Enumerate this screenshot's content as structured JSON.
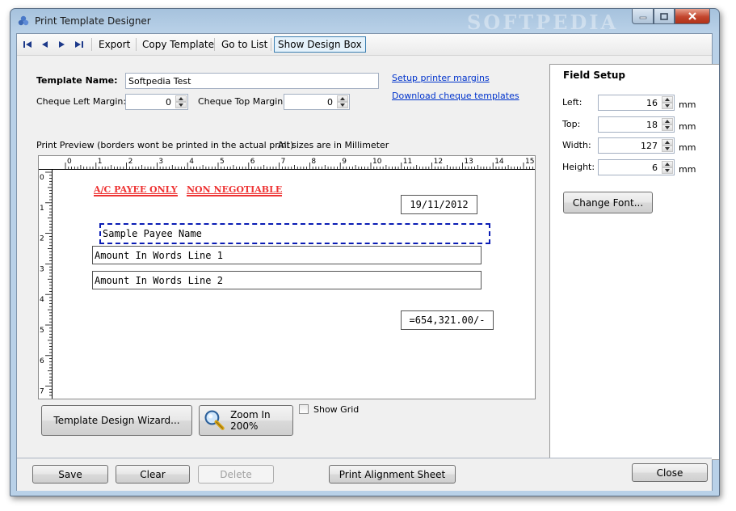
{
  "window": {
    "title": "Print Template Designer",
    "watermark": "SOFTPEDIA"
  },
  "toolbar": {
    "nav": [
      "first-icon",
      "prev-icon",
      "next-icon",
      "last-icon"
    ],
    "export": "Export",
    "copy_template": "Copy Template",
    "go_to_list": "Go to List",
    "show_design_box": "Show Design Box"
  },
  "form": {
    "template_name_label": "Template Name:",
    "template_name_value": "Softpedia Test",
    "cheque_left_margin_label": "Cheque Left Margin:",
    "cheque_left_margin_value": "0",
    "cheque_top_margin_label": "Cheque Top Margin:",
    "cheque_top_margin_value": "0",
    "setup_printer_margins": "Setup printer margins",
    "download_cheque_templates": "Download cheque templates"
  },
  "preview": {
    "caption": "Print Preview (borders wont be printed in the actual print)",
    "units_note": "All sizes are in Millimeter",
    "ruler_top": [
      "0",
      "1",
      "2",
      "3",
      "4",
      "5",
      "6",
      "7",
      "8",
      "9",
      "10",
      "11",
      "12",
      "13",
      "14",
      "15"
    ],
    "ruler_left": [
      "0",
      "1",
      "2",
      "3",
      "4",
      "5",
      "6",
      "7"
    ],
    "stamps": {
      "payee_only": "A/C PAYEE ONLY",
      "non_negotiable": "NON NEGOTIABLE"
    },
    "date": "19/11/2012",
    "payee": "Sample Payee Name",
    "amount_line_1": "Amount In Words Line 1",
    "amount_line_2": "Amount In Words Line 2",
    "amount": "=654,321.00/-"
  },
  "preview_actions": {
    "wizard": "Template Design Wizard...",
    "zoom": "Zoom In 200%",
    "show_grid": "Show Grid",
    "show_grid_checked": false
  },
  "field_setup": {
    "title": "Field Setup",
    "left_label": "Left:",
    "left_value": "16",
    "top_label": "Top:",
    "top_value": "18",
    "width_label": "Width:",
    "width_value": "127",
    "height_label": "Height:",
    "height_value": "6",
    "unit": "mm",
    "change_font": "Change Font..."
  },
  "bottom": {
    "save": "Save",
    "clear": "Clear",
    "delete": "Delete",
    "print_alignment": "Print Alignment Sheet",
    "close": "Close"
  },
  "colors": {
    "stamp_red": "#e33333",
    "selection_blue": "#0a1cb4",
    "link_blue": "#0033cc"
  }
}
